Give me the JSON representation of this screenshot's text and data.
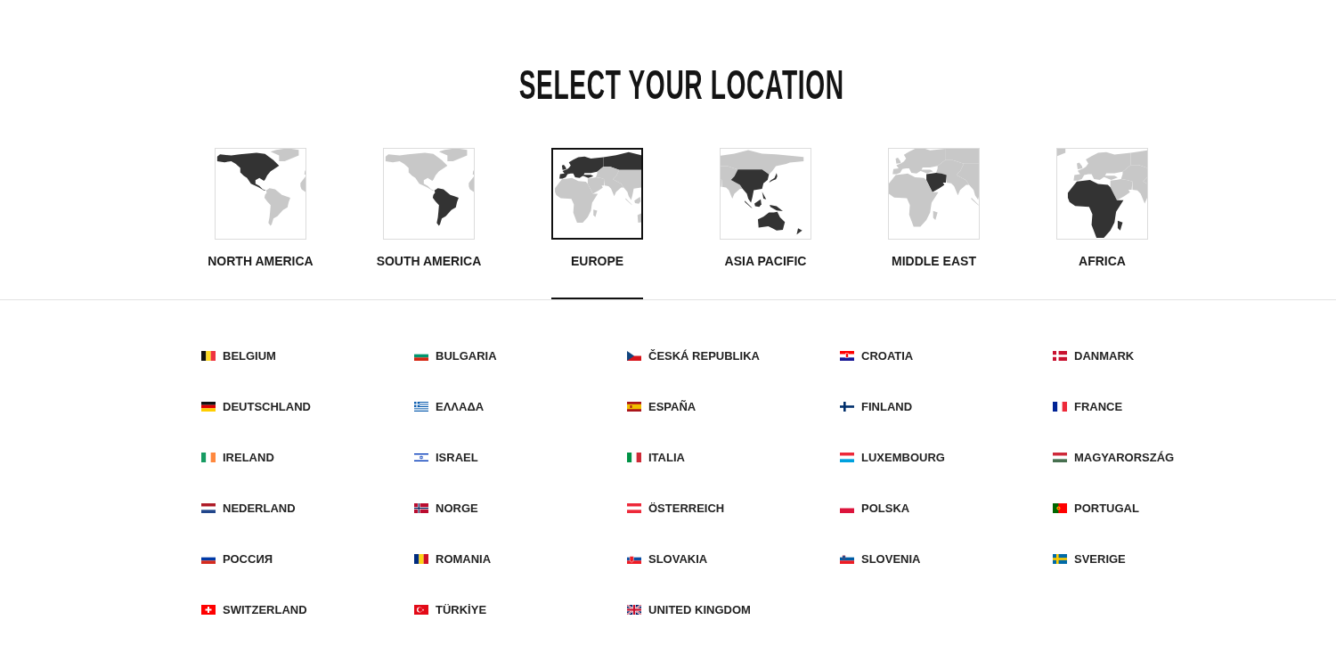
{
  "title": "SELECT YOUR LOCATION",
  "regions": [
    {
      "label": "NORTH AMERICA",
      "kind": "na",
      "selected": false
    },
    {
      "label": "SOUTH AMERICA",
      "kind": "sa",
      "selected": false
    },
    {
      "label": "EUROPE",
      "kind": "eu",
      "selected": true
    },
    {
      "label": "ASIA PACIFIC",
      "kind": "ap",
      "selected": false
    },
    {
      "label": "MIDDLE EAST",
      "kind": "me",
      "selected": false
    },
    {
      "label": "AFRICA",
      "kind": "af",
      "selected": false
    }
  ],
  "countries": [
    {
      "name": "BELGIUM",
      "kind": "be"
    },
    {
      "name": "BULGARIA",
      "kind": "bg"
    },
    {
      "name": "ČESKÁ REPUBLIKA",
      "kind": "cz"
    },
    {
      "name": "CROATIA",
      "kind": "hr"
    },
    {
      "name": "DANMARK",
      "kind": "dk"
    },
    {
      "name": "DEUTSCHLAND",
      "kind": "de"
    },
    {
      "name": "ΕΛΛΑΔΑ",
      "kind": "gr"
    },
    {
      "name": "ESPAÑA",
      "kind": "es"
    },
    {
      "name": "FINLAND",
      "kind": "fi"
    },
    {
      "name": "FRANCE",
      "kind": "fr"
    },
    {
      "name": "IRELAND",
      "kind": "ie"
    },
    {
      "name": "ISRAEL",
      "kind": "il"
    },
    {
      "name": "ITALIA",
      "kind": "it"
    },
    {
      "name": "LUXEMBOURG",
      "kind": "lu"
    },
    {
      "name": "MAGYARORSZÁG",
      "kind": "hu"
    },
    {
      "name": "NEDERLAND",
      "kind": "nl"
    },
    {
      "name": "NORGE",
      "kind": "no"
    },
    {
      "name": "ÖSTERREICH",
      "kind": "at"
    },
    {
      "name": "POLSKA",
      "kind": "pl"
    },
    {
      "name": "PORTUGAL",
      "kind": "pt"
    },
    {
      "name": "РОССИЯ",
      "kind": "ru"
    },
    {
      "name": "ROMANIA",
      "kind": "ro"
    },
    {
      "name": "SLOVAKIA",
      "kind": "sk"
    },
    {
      "name": "SLOVENIA",
      "kind": "si"
    },
    {
      "name": "SVERIGE",
      "kind": "se"
    },
    {
      "name": "SWITZERLAND",
      "kind": "ch"
    },
    {
      "name": "TÜRKİYE",
      "kind": "tr"
    },
    {
      "name": "UNITED KINGDOM",
      "kind": "gb"
    }
  ]
}
